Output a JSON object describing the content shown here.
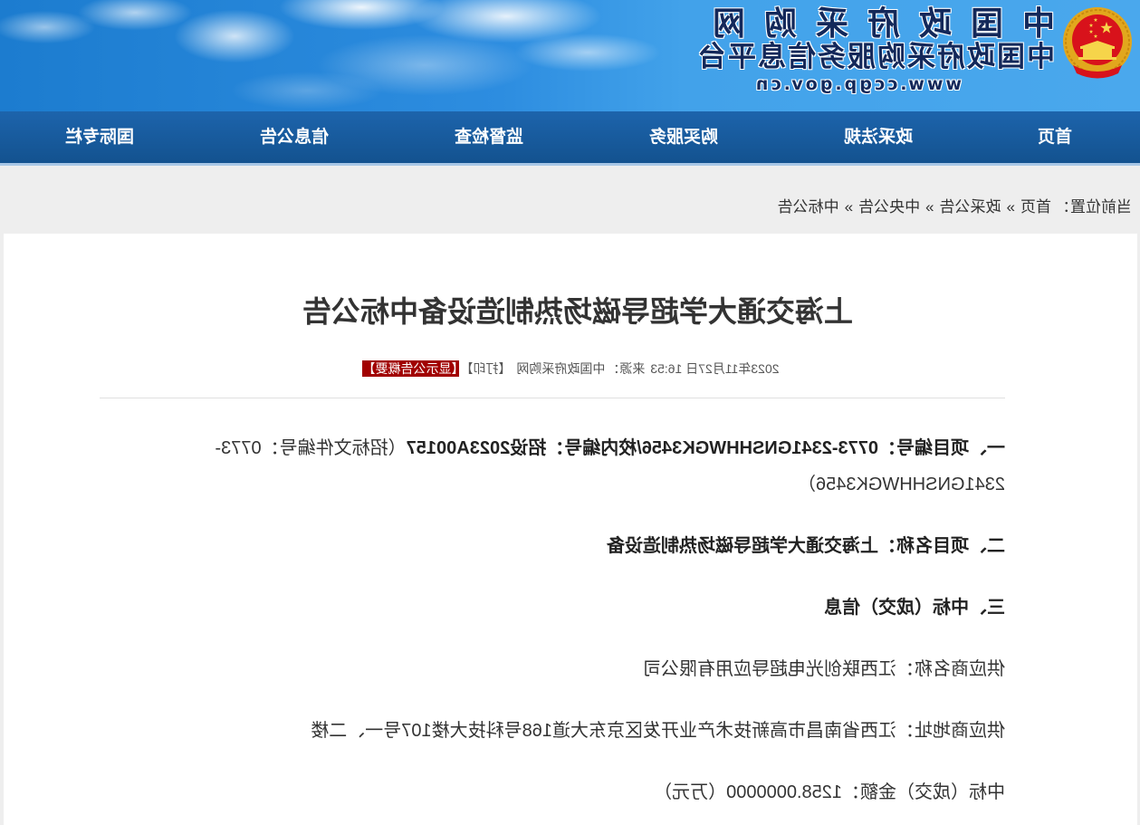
{
  "header": {
    "site_title": "中国政府采购网",
    "site_subtitle": "中国政府采购服务信息平台",
    "site_url": "www.ccgp.gov.cn",
    "emblem_icon": "national-emblem-icon"
  },
  "nav": {
    "items": [
      {
        "label": "首页"
      },
      {
        "label": "政采法规"
      },
      {
        "label": "购买服务"
      },
      {
        "label": "监督检查"
      },
      {
        "label": "信息公告"
      },
      {
        "label": "国际专栏"
      }
    ]
  },
  "breadcrumb": {
    "prefix": "当前位置：",
    "separator": "»",
    "items": [
      "首页",
      "政采公告",
      "中央公告",
      "中标公告"
    ]
  },
  "article": {
    "title": "上海交通大学超导磁场热制造设备中标公告",
    "meta": {
      "datetime": "2023年11月27日 16:53",
      "source_prefix": "来源：",
      "source": "中国政府采购网",
      "print": "【打印】",
      "summary_toggle": "【显示公告概要】"
    },
    "sections": {
      "project_number_bold": "一、项目编号：0773-2341GNSHHWGK3456/校内编号：招设2023A00157",
      "project_number_note": "（招标文件编号：0773-2341GNSHHWGK3456）",
      "project_name": "二、项目名称：上海交通大学超导磁场热制造设备",
      "award_heading": "三、中标（成交）信息",
      "supplier_name": "供应商名称：江西联创光电超导应用有限公司",
      "supplier_address": "供应商地址：江西省南昌市高新技术产业开发区京东大道168号科技大楼107号一、二楼",
      "award_amount": "中标（成交）金额：1258.0000000（万元）"
    }
  },
  "colors": {
    "sky": "#2d8de0",
    "nav_bg": "#17599f",
    "badge_bg": "#a10000",
    "title_text": "#13285a",
    "page_bg": "#eeeeee"
  }
}
